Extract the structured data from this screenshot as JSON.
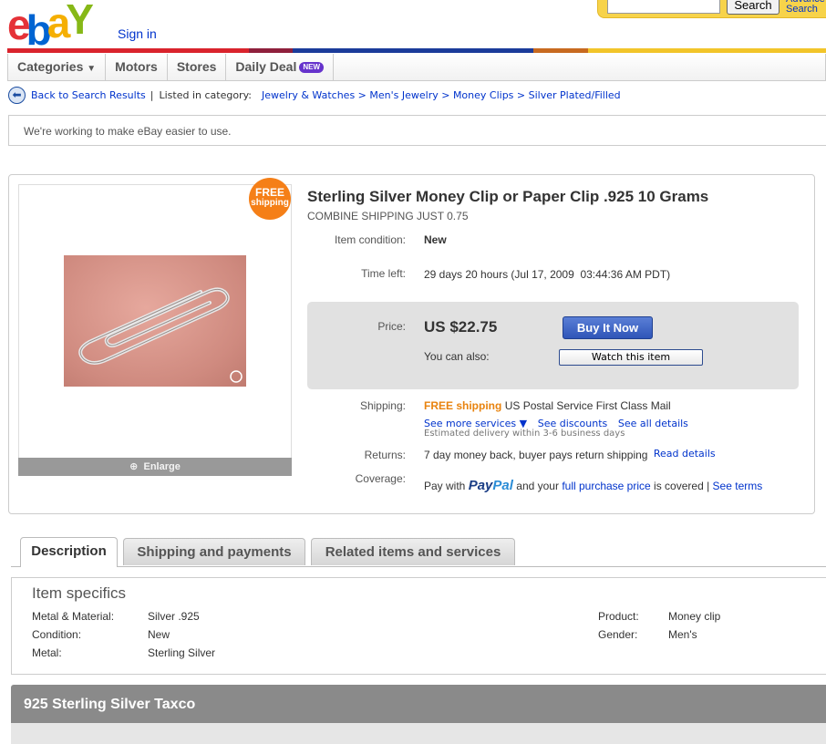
{
  "header": {
    "logo_letters": [
      "e",
      "b",
      "a",
      "Y"
    ],
    "logo_colors": [
      "#e53238",
      "#0064d2",
      "#f5af02",
      "#86b817"
    ],
    "sign_in": "Sign in",
    "search_button": "Search",
    "advanced_search": "Advance Search"
  },
  "nav": {
    "categories": "Categories",
    "motors": "Motors",
    "stores": "Stores",
    "daily_deal": "Daily Deal",
    "new_badge": "NEW"
  },
  "breadcrumb": {
    "back": "Back to Search Results",
    "separator": "|",
    "listed_in": "Listed in category:",
    "path": "Jewelry & Watches > Men's Jewelry > Money Clips > Silver Plated/Filled"
  },
  "notice": "We're working to make eBay easier to use.",
  "item": {
    "badge_line1": "FREE",
    "badge_line2": "shipping",
    "enlarge": "Enlarge",
    "title": "Sterling Silver Money Clip or Paper Clip .925 10 Grams",
    "subtitle": "COMBINE SHIPPING JUST 0.75",
    "condition_label": "Item condition:",
    "condition": "New",
    "time_left_label": "Time left:",
    "time_left": "29 days 20 hours (Jul 17, 2009  03:44:36 AM PDT)",
    "price_label": "Price:",
    "price": "US $22.75",
    "buy_now": "Buy It Now",
    "also_label": "You can also:",
    "watch": "Watch this item",
    "shipping_label": "Shipping:",
    "free_shipping": "FREE shipping",
    "shipping_service": "US Postal Service First Class Mail",
    "see_more_services": "See more services ▼",
    "see_discounts": "See discounts",
    "see_all_details": "See all details",
    "delivery": "Estimated delivery within 3-6 business days",
    "returns_label": "Returns:",
    "returns": "7 day money back, buyer pays return shipping",
    "read_details": "Read details",
    "coverage_label": "Coverage:",
    "coverage_pre": "Pay with",
    "paypal_a": "Pay",
    "paypal_b": "Pal",
    "coverage_mid": "and your",
    "coverage_link": "full purchase price",
    "coverage_post": "is covered |",
    "see_terms": "See terms"
  },
  "tabs": {
    "description": "Description",
    "shipping": "Shipping and payments",
    "related": "Related items and services"
  },
  "specifics": {
    "title": "Item specifics",
    "left": [
      {
        "k": "Metal & Material:",
        "v": "Silver .925"
      },
      {
        "k": "Condition:",
        "v": "New"
      },
      {
        "k": "Metal:",
        "v": "Sterling Silver"
      }
    ],
    "right": [
      {
        "k": "Product:",
        "v": "Money clip"
      },
      {
        "k": "Gender:",
        "v": "Men's"
      }
    ]
  },
  "description_header": "925 Sterling Silver Taxco"
}
